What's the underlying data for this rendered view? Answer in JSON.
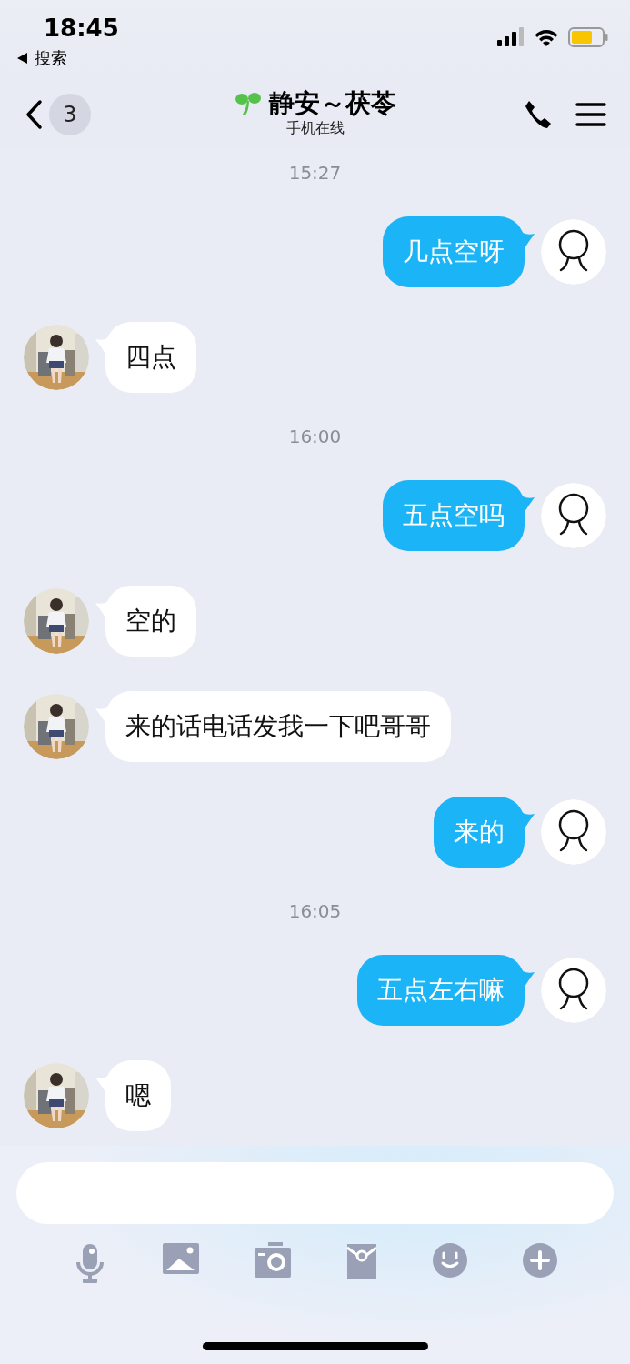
{
  "status_bar": {
    "time": "18:45",
    "back_app": "搜索"
  },
  "header": {
    "unread_count": "3",
    "title": "静安～茯苓",
    "subtitle": "手机在线"
  },
  "messages": [
    {
      "kind": "time",
      "text": "15:27"
    },
    {
      "kind": "sent",
      "text": "几点空呀"
    },
    {
      "kind": "received",
      "text": "四点"
    },
    {
      "kind": "time",
      "text": "16:00"
    },
    {
      "kind": "sent",
      "text": "五点空吗"
    },
    {
      "kind": "received",
      "text": "空的"
    },
    {
      "kind": "received",
      "text": "来的话电话发我一下吧哥哥"
    },
    {
      "kind": "sent",
      "text": "来的"
    },
    {
      "kind": "time",
      "text": "16:05"
    },
    {
      "kind": "sent",
      "text": "五点左右嘛"
    },
    {
      "kind": "received",
      "text": "嗯"
    }
  ]
}
